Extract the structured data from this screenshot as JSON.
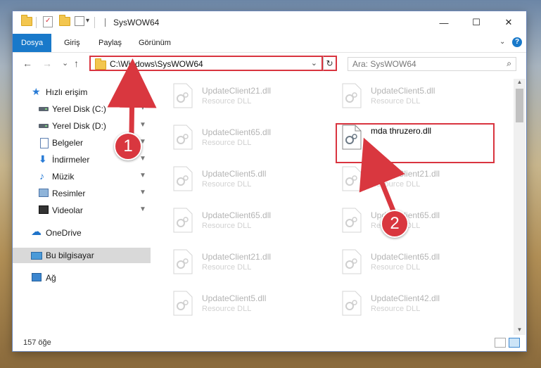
{
  "window": {
    "title": "SysWOW64",
    "minimize": "—",
    "maximize": "☐",
    "close": "✕"
  },
  "quick_access_toolbar": {
    "dropdown": "▾"
  },
  "ribbon": {
    "tabs": [
      "Dosya",
      "Giriş",
      "Paylaş",
      "Görünüm"
    ],
    "expand": "⌄",
    "help": "?"
  },
  "nav": {
    "back": "←",
    "forward": "→",
    "recent": "⌄",
    "up": "↑",
    "address": "C:\\Windows\\SysWOW64",
    "address_dropdown": "⌄",
    "refresh": "↻",
    "search_placeholder": "Ara: SysWOW64",
    "search_icon": "⌕"
  },
  "sidebar": {
    "items": [
      {
        "label": "Hızlı erişim",
        "icon": "star-icon",
        "pinned": false
      },
      {
        "label": "Yerel Disk (C:)",
        "icon": "drive-icon",
        "pinned": true
      },
      {
        "label": "Yerel Disk (D:)",
        "icon": "drive-icon",
        "pinned": true
      },
      {
        "label": "Belgeler",
        "icon": "documents-icon",
        "pinned": true
      },
      {
        "label": "İndirmeler",
        "icon": "downloads-icon",
        "pinned": true
      },
      {
        "label": "Müzik",
        "icon": "music-icon",
        "pinned": true
      },
      {
        "label": "Resimler",
        "icon": "pictures-icon",
        "pinned": true
      },
      {
        "label": "Videolar",
        "icon": "videos-icon",
        "pinned": true
      },
      {
        "label": "OneDrive",
        "icon": "onedrive-icon",
        "pinned": false
      },
      {
        "label": "Bu bilgisayar",
        "icon": "this-pc-icon",
        "pinned": false,
        "selected": true
      },
      {
        "label": "Ağ",
        "icon": "network-icon",
        "pinned": false
      }
    ],
    "pin_glyph": "📌"
  },
  "files": [
    {
      "name": "UpdateClient21.dll",
      "desc": "Resource DLL"
    },
    {
      "name": "UpdateClient5.dll",
      "desc": "Resource DLL"
    },
    {
      "name": "UpdateClient65.dll",
      "desc": "Resource DLL"
    },
    {
      "name": "mda thruzero.dll",
      "desc": "",
      "highlighted": true
    },
    {
      "name": "UpdateClient5.dll",
      "desc": "Resource DLL"
    },
    {
      "name": "UpdateClient21.dll",
      "desc": "Resource DLL"
    },
    {
      "name": "UpdateClient65.dll",
      "desc": "Resource DLL"
    },
    {
      "name": "UpdateClient65.dll",
      "desc": "Resource DLL"
    },
    {
      "name": "UpdateClient21.dll",
      "desc": "Resource DLL"
    },
    {
      "name": "UpdateClient65.dll",
      "desc": "Resource DLL"
    },
    {
      "name": "UpdateClient5.dll",
      "desc": "Resource DLL"
    },
    {
      "name": "UpdateClient42.dll",
      "desc": "Resource DLL"
    }
  ],
  "status": {
    "item_count": "157 öğe"
  },
  "callouts": [
    "1",
    "2"
  ],
  "colors": {
    "accent": "#1979ca",
    "highlight_red": "#d9343f",
    "selection": "#d9d9d9"
  }
}
